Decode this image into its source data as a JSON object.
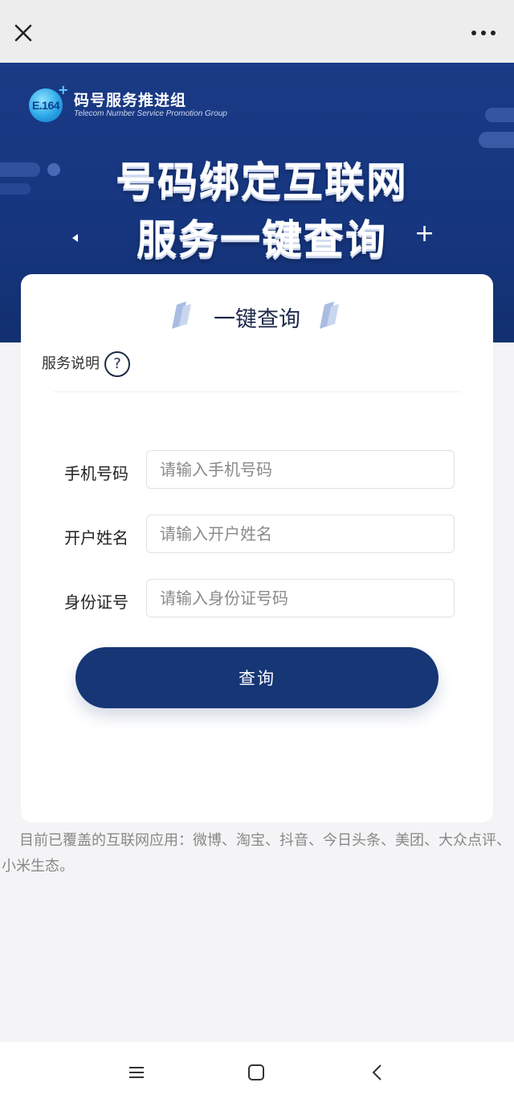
{
  "topbar": {
    "close_icon": "close-icon",
    "more_icon": "more-dots-icon"
  },
  "banner": {
    "logo_text": "E.164",
    "org_name": "码号服务推进组",
    "org_en": "Telecom Number Service  Promotion Group",
    "headline_line1": "号码绑定互联网",
    "headline_line2": "服务一键查询",
    "accent": "#1a3a85"
  },
  "card": {
    "title": "一键查询",
    "help_label": "服务说明",
    "help_icon_text": "?",
    "fields": [
      {
        "label": "手机号码",
        "placeholder": "请输入手机号码",
        "value": ""
      },
      {
        "label": "开户姓名",
        "placeholder": "请输入开户姓名",
        "value": ""
      },
      {
        "label": "身份证号",
        "placeholder": "请输入身份证号码",
        "value": ""
      }
    ],
    "submit_label": "查询",
    "button_color": "#163676"
  },
  "coverage": {
    "text": "目前已覆盖的互联网应用：微博、淘宝、抖音、今日头条、美团、大众点评、小米生态。"
  },
  "navbar": {
    "menu_icon": "menu-icon",
    "home_icon": "home-icon",
    "back_icon": "back-icon"
  }
}
